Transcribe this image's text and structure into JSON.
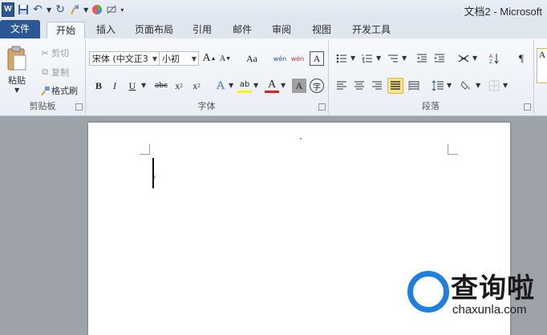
{
  "window": {
    "title": "文档2 - Microsoft"
  },
  "qat": {
    "app_icon": "W"
  },
  "tabs": [
    {
      "label": "文件"
    },
    {
      "label": "开始"
    },
    {
      "label": "插入"
    },
    {
      "label": "页面布局"
    },
    {
      "label": "引用"
    },
    {
      "label": "邮件"
    },
    {
      "label": "审阅"
    },
    {
      "label": "视图"
    },
    {
      "label": "开发工具"
    }
  ],
  "clipboard": {
    "paste": "粘贴",
    "cut": "剪切",
    "copy": "复制",
    "format_painter": "格式刷",
    "group_label": "剪贴板"
  },
  "font": {
    "font_name": "宋体 (中文正3",
    "font_size": "小初",
    "grow": "A",
    "shrink": "A",
    "case": "Aa",
    "phonetic": "wén",
    "wubi": "wén",
    "border_char": "A",
    "bold": "B",
    "italic": "I",
    "underline": "U",
    "strike": "abc",
    "subscript": "x",
    "sub_mark": "2",
    "superscript": "x",
    "sup_mark": "2",
    "effects": "A",
    "highlight": "ab",
    "font_color": "A",
    "shading": "A",
    "enclose": "字",
    "group_label": "字体"
  },
  "paragraph": {
    "group_label": "段落"
  },
  "styles": {
    "first": "A"
  },
  "colors": {
    "accent": "#2b5797",
    "highlight": "#fde38a",
    "font_red": "#e02020",
    "watermark_blue": "#1d7fe0"
  },
  "watermark": {
    "title": "查询啦",
    "subtitle": "chaxunla.com"
  }
}
